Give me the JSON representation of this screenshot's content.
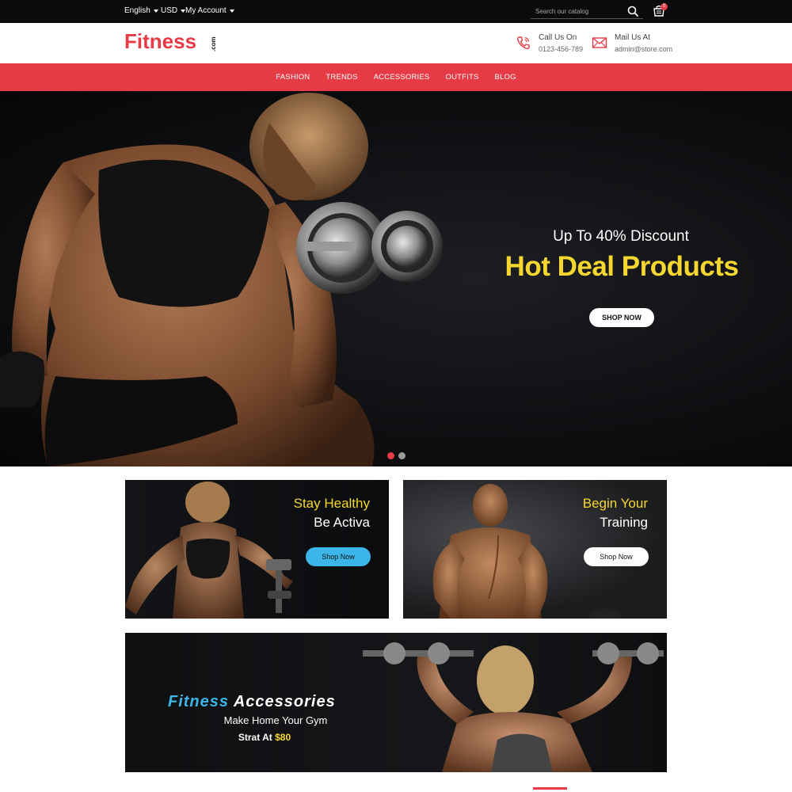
{
  "topbar": {
    "language": "English",
    "currency": "USD",
    "account": "My Account",
    "search_placeholder": "Search our catalog",
    "cart_count": "0"
  },
  "header": {
    "logo_main": "Fitness",
    "logo_suffix": ".com",
    "call_label": "Call Us On",
    "call_value": "0123-456-789",
    "mail_label": "Mail Us At",
    "mail_value": "admin@store.com"
  },
  "nav": {
    "items": [
      "FASHION",
      "TRENDS",
      "ACCESSORIES",
      "OUTFITS",
      "BLOG"
    ]
  },
  "hero": {
    "subtitle": "Up To 40% Discount",
    "title": "Hot Deal Products",
    "button": "SHOP NOW",
    "slides_total": 2,
    "active_slide": 1
  },
  "banners": {
    "left": {
      "line1": "Stay Healthy",
      "line2": "Be Activa",
      "button": "Shop Now"
    },
    "right": {
      "line1": "Begin Your",
      "line2": "Training",
      "button": "Shop Now"
    },
    "wide": {
      "title_a": "Fitness",
      "title_b": "Accessories",
      "subtitle": "Make Home Your Gym",
      "price_prefix": "Strat At",
      "price": "$80"
    }
  },
  "colors": {
    "accent": "#e63b45",
    "highlight": "#f5d730",
    "button_blue": "#3cb6e8",
    "topbar": "#0b0b0b"
  }
}
